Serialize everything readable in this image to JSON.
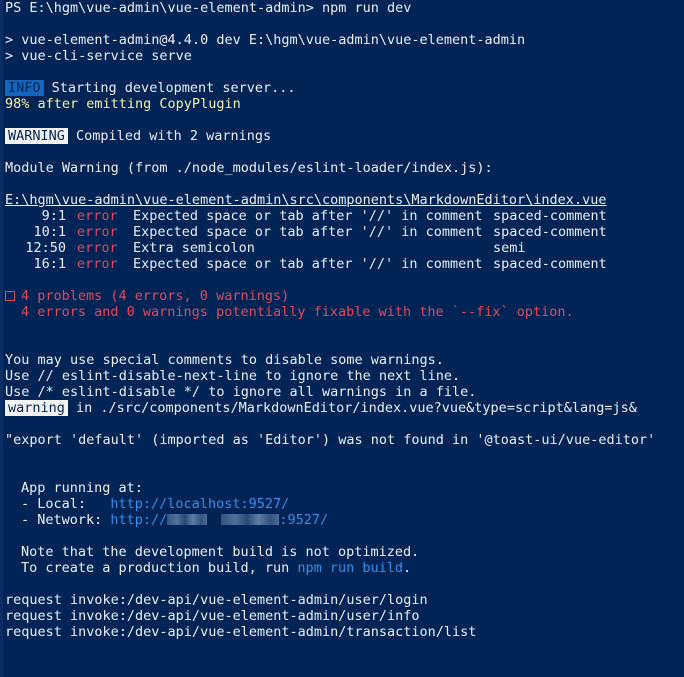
{
  "window": {
    "background": "#012456",
    "text_color": "#eeedf0"
  },
  "prompt": {
    "text": "PS E:\\hgm\\vue-admin\\vue-element-admin> npm run dev"
  },
  "script_echo": {
    "line1": "> vue-element-admin@4.4.0 dev E:\\hgm\\vue-admin\\vue-element-admin",
    "line2": "> vue-cli-service serve"
  },
  "info": {
    "badge": "INFO",
    "message": "Starting development server...",
    "progress_text": "98% after emitting CopyPlugin"
  },
  "warning_header": {
    "badge": "WARNING",
    "message": "Compiled with 2 warnings"
  },
  "module_warning": {
    "heading": "Module Warning (from ./node_modules/eslint-loader/index.js):",
    "file_path": "E:\\hgm\\vue-admin\\vue-element-admin\\src\\components\\MarkdownEditor\\index.vue",
    "rows": [
      {
        "pos": "9:1",
        "level": "error",
        "message": "Expected space or tab after '//' in comment",
        "rule": "spaced-comment"
      },
      {
        "pos": "10:1",
        "level": "error",
        "message": "Expected space or tab after '//' in comment",
        "rule": "spaced-comment"
      },
      {
        "pos": "12:50",
        "level": "error",
        "message": "Extra semicolon",
        "rule": "semi"
      },
      {
        "pos": "16:1",
        "level": "error",
        "message": "Expected space or tab after '//' in comment",
        "rule": "spaced-comment"
      }
    ],
    "summary_line1": "4 problems (4 errors, 0 warnings)",
    "summary_line2": "4 errors and 0 warnings potentially fixable with the `--fix` option."
  },
  "hints": {
    "line1": "You may use special comments to disable some warnings.",
    "line2": "Use // eslint-disable-next-line to ignore the next line.",
    "line3": "Use /* eslint-disable */ to ignore all warnings in a file."
  },
  "second_warning": {
    "badge": "warning",
    "message": "in ./src/components/MarkdownEditor/index.vue?vue&type=script&lang=js&",
    "detail": "\"export 'default' (imported as 'Editor') was not found in '@toast-ui/vue-editor'"
  },
  "app_running": {
    "heading": "App running at:",
    "local_label": "- Local:   ",
    "local_url_visible": "http://localhost:9527/",
    "network_label": "- Network: ",
    "network_url_prefix": "http://",
    "network_url_suffix": ":9527/"
  },
  "build_note": {
    "line1": "Note that the development build is not optimized.",
    "line2_prefix": "To create a production build, run ",
    "line2_command": "npm run build",
    "line2_suffix": "."
  },
  "requests": [
    "request invoke:/dev-api/vue-element-admin/user/login",
    "request invoke:/dev-api/vue-element-admin/user/info",
    "request invoke:/dev-api/vue-element-admin/transaction/list"
  ]
}
